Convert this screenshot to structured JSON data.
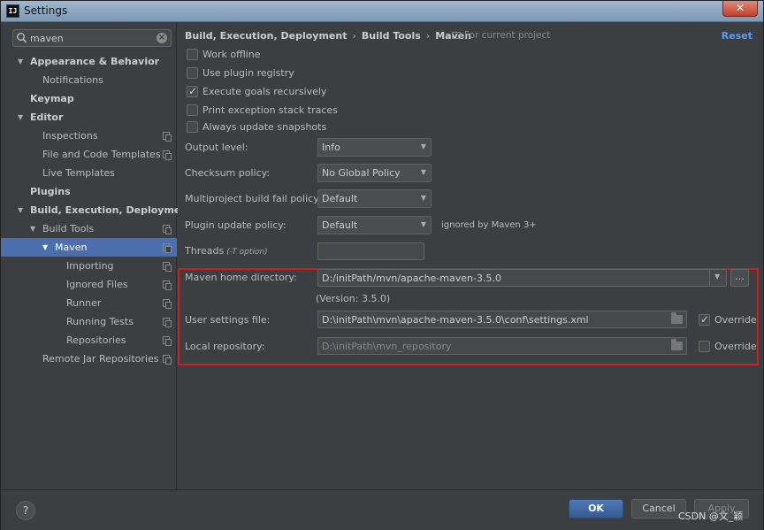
{
  "window": {
    "title": "Settings",
    "app_icon": "IJ",
    "close": "✕"
  },
  "sidebar": {
    "search": {
      "value": "maven",
      "placeholder": ""
    },
    "items": [
      {
        "label": "Appearance & Behavior",
        "arrow": "▼"
      },
      {
        "label": "Notifications"
      },
      {
        "label": "Keymap"
      },
      {
        "label": "Editor",
        "arrow": "▼"
      },
      {
        "label": "Inspections"
      },
      {
        "label": "File and Code Templates"
      },
      {
        "label": "Live Templates"
      },
      {
        "label": "Plugins"
      },
      {
        "label": "Build, Execution, Deployment",
        "arrow": "▼"
      },
      {
        "label": "Build Tools",
        "arrow": "▼"
      },
      {
        "label": "Maven",
        "arrow": "▼"
      },
      {
        "label": "Importing"
      },
      {
        "label": "Ignored Files"
      },
      {
        "label": "Runner"
      },
      {
        "label": "Running Tests"
      },
      {
        "label": "Repositories"
      },
      {
        "label": "Remote Jar Repositories"
      }
    ]
  },
  "main": {
    "breadcrumb": [
      "Build, Execution, Deployment",
      "Build Tools",
      "Maven"
    ],
    "breadcrumb_sep": "›",
    "project_note": "For current project",
    "reset": "Reset",
    "checkboxes": [
      {
        "label": "Work offline",
        "checked": false
      },
      {
        "label": "Use plugin registry",
        "checked": false
      },
      {
        "label": "Execute goals recursively",
        "checked": true
      },
      {
        "label": "Print exception stack traces",
        "checked": false
      },
      {
        "label": "Always update snapshots",
        "checked": false
      }
    ],
    "output_level": {
      "label": "Output level:",
      "value": "Info"
    },
    "checksum_policy": {
      "label": "Checksum policy:",
      "value": "No Global Policy"
    },
    "multiproject_policy": {
      "label": "Multiproject build fail policy:",
      "value": "Default"
    },
    "plugin_update_policy": {
      "label": "Plugin update policy:",
      "value": "Default",
      "note": "ignored by Maven 3+"
    },
    "threads": {
      "label": "Threads",
      "hint": "(-T option)",
      "value": ""
    },
    "maven_home": {
      "label": "Maven home directory:",
      "value": "D:/initPath/mvn/apache-maven-3.5.0",
      "browse": "...",
      "version": "(Version: 3.5.0)"
    },
    "user_settings": {
      "label": "User settings file:",
      "value": "D:\\initPath\\mvn\\apache-maven-3.5.0\\conf\\settings.xml",
      "override_label": "Override",
      "override": true
    },
    "local_repo": {
      "label": "Local repository:",
      "value": "D:\\initPath\\mvn_repository",
      "override_label": "Override",
      "override": false
    }
  },
  "footer": {
    "help": "?",
    "ok": "OK",
    "cancel": "Cancel",
    "apply": "Apply",
    "watermark": "CSDN @文_颖"
  },
  "colors": {
    "selection": "#4b6eaf",
    "accent_link": "#589df6",
    "highlight_border": "#d21d1d",
    "ok_button": "#4d7ab8"
  }
}
